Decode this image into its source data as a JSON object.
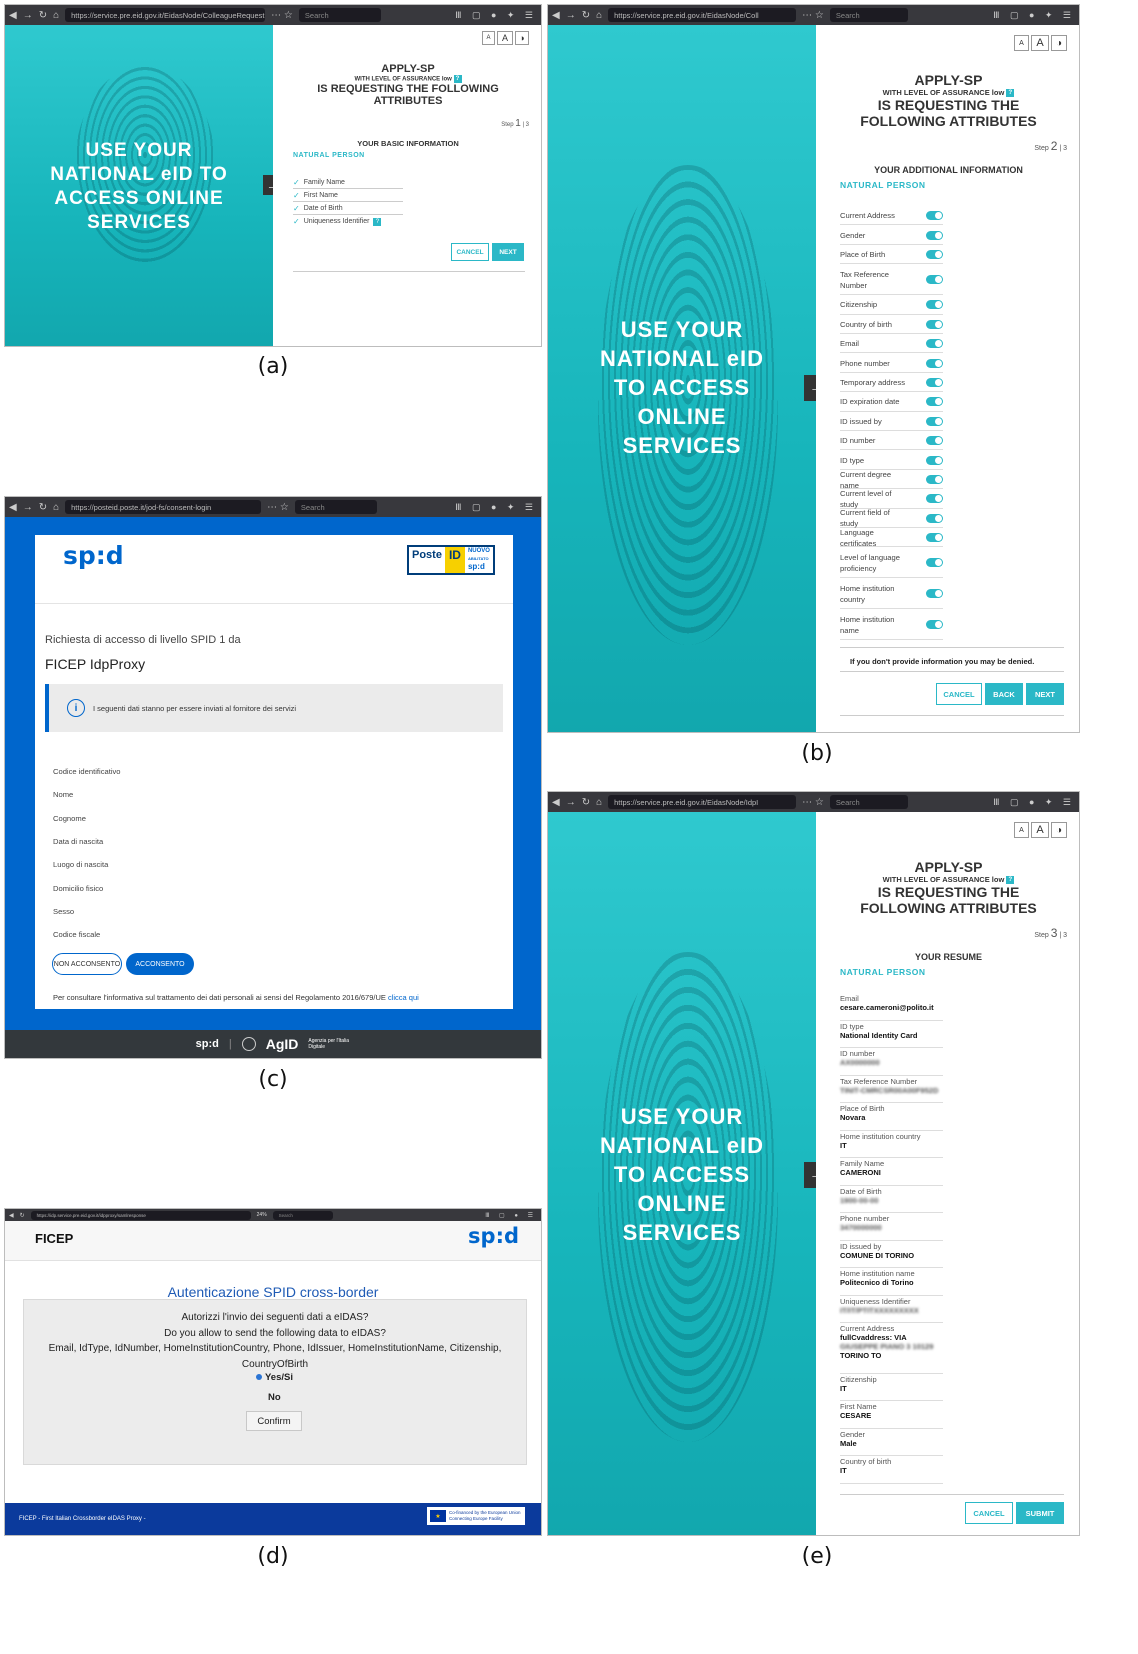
{
  "captions": {
    "a": "(a)",
    "b": "(b)",
    "c": "(c)",
    "d": "(d)",
    "e": "(e)"
  },
  "chrome": {
    "a_url": "https://service.pre.eid.gov.it/EidasNode/ColleagueRequest",
    "b_url": "https://service.pre.eid.gov.it/EidasNode/Coll",
    "c_url": "https://posteid.poste.it/jod-fs/consent-login",
    "d_url": "https://idp.service.pre.eid.gov.it/idpproxy/samlresponse",
    "d_zoom": "24%",
    "e_url": "https://service.pre.eid.gov.it/EidasNode/IdpI",
    "search_placeholder": "Search"
  },
  "eidas": {
    "hero_lines_a": [
      "USE YOUR",
      "NATIONAL eID TO",
      "ACCESS ONLINE",
      "SERVICES"
    ],
    "hero_lines_be": [
      "USE YOUR",
      "NATIONAL eID",
      "TO ACCESS",
      "ONLINE",
      "SERVICES"
    ],
    "font_small": "A",
    "font_large": "A",
    "contrast": "◑",
    "apply_title": "APPLY-SP",
    "assurance": "WITH LEVEL OF ASSURANCE low",
    "requesting_a": "IS REQUESTING THE FOLLOWING",
    "attributes_a": "ATTRIBUTES",
    "requesting_be_1": "IS REQUESTING THE",
    "requesting_be_2": "FOLLOWING ATTRIBUTES",
    "step_label": "Step",
    "step_total": "| 3",
    "natural_person": "NATURAL PERSON",
    "cancel": "CANCEL",
    "next": "NEXT",
    "back": "BACK",
    "submit": "SUBMIT",
    "q": "?"
  },
  "panel_a": {
    "step_num": "1",
    "section": "YOUR BASIC INFORMATION",
    "attributes": [
      "Family Name",
      "First Name",
      "Date of Birth",
      "Uniqueness Identifier"
    ]
  },
  "panel_b": {
    "step_num": "2",
    "section": "YOUR ADDITIONAL INFORMATION",
    "attributes": [
      "Current Address",
      "Gender",
      "Place of Birth",
      "Tax Reference Number",
      "Citizenship",
      "Country of birth",
      "Email",
      "Phone number",
      "Temporary address",
      "ID expiration date",
      "ID issued by",
      "ID number",
      "ID type",
      "Current degree name",
      "Current level of study",
      "Current field of study",
      "Language certificates",
      "Level of language proficiency",
      "Home institution country",
      "Home institution name"
    ],
    "warning": "If you don't provide information you may be denied."
  },
  "panel_e": {
    "step_num": "3",
    "section": "YOUR RESUME",
    "fields": [
      {
        "label": "Email",
        "value": "cesare.cameroni@polito.it"
      },
      {
        "label": "ID type",
        "value": "National Identity Card"
      },
      {
        "label": "ID number",
        "value": "AX0000000"
      },
      {
        "label": "Tax Reference Number",
        "value": "TINIT-CMRCSR00A00F952D"
      },
      {
        "label": "Place of Birth",
        "value": "Novara"
      },
      {
        "label": "Home institution country",
        "value": "IT"
      },
      {
        "label": "Family Name",
        "value": "CAMERONI"
      },
      {
        "label": "Date of Birth",
        "value": "1900-00-00"
      },
      {
        "label": "Phone number",
        "value": "3470000000"
      },
      {
        "label": "ID issued by",
        "value": "COMUNE DI TORINO"
      },
      {
        "label": "Home institution name",
        "value": "Politecnico di Torino"
      },
      {
        "label": "Uniqueness Identifier",
        "value": "IT/IT/PTITXXXXXXXXX"
      },
      {
        "label": "Current Address",
        "value": "fullCvaddress: VIA",
        "value2": "GIUSEPPE PIANO 3 10129",
        "value3": "TORINO TO"
      },
      {
        "label": "Citizenship",
        "value": "IT"
      },
      {
        "label": "First Name",
        "value": "CESARE"
      },
      {
        "label": "Gender",
        "value": "Male"
      },
      {
        "label": "Country of birth",
        "value": "IT"
      }
    ]
  },
  "panel_c": {
    "spid_logo": "sp:d",
    "poste": "Poste",
    "poste_id": "ID",
    "poste_nuovo": "NUOVO",
    "poste_abilitato": "ABILITATO",
    "poste_spid": "sp:d",
    "request_line": "Richiesta di accesso di livello SPID 1 da",
    "requester": "FICEP IdpProxy",
    "info": "I seguenti dati stanno per essere inviati al fornitore dei servizi",
    "fields": [
      "Codice identificativo",
      "Nome",
      "Cognome",
      "Data di nascita",
      "Luogo di nascita",
      "Domicilio fisico",
      "Sesso",
      "Codice fiscale"
    ],
    "deny": "NON ACCONSENTO",
    "accept": "ACCONSENTO",
    "privacy": "Per consultare l'informativa sul trattamento dei dati personali ai sensi del Regolamento 2016/679/UE",
    "privacy_link": "clicca qui",
    "footer_spid": "sp:d",
    "footer_agid": "AgID",
    "footer_agid_sub": "Agenzia per l'Italia Digitale"
  },
  "panel_d": {
    "brand": "FICEP",
    "spid_logo": "sp:d",
    "title": "Autenticazione SPID cross-border",
    "q_it": "Autorizzi l'invio dei seguenti dati a eIDAS?",
    "q_en": "Do you allow to send the following data to eIDAS?",
    "attrs_1": "Email, IdType, IdNumber, HomeInstitutionCountry, Phone, IdIssuer, HomeInstitutionName, Citizenship,",
    "attrs_2": "CountryOfBirth",
    "yes": "Yes/Si",
    "no": "No",
    "confirm": "Confirm",
    "footer": "FICEP - First Italian Crossborder eIDAS Proxy -",
    "eu_1": "Co-financed by the European Union",
    "eu_2": "Connecting Europe Facility"
  }
}
